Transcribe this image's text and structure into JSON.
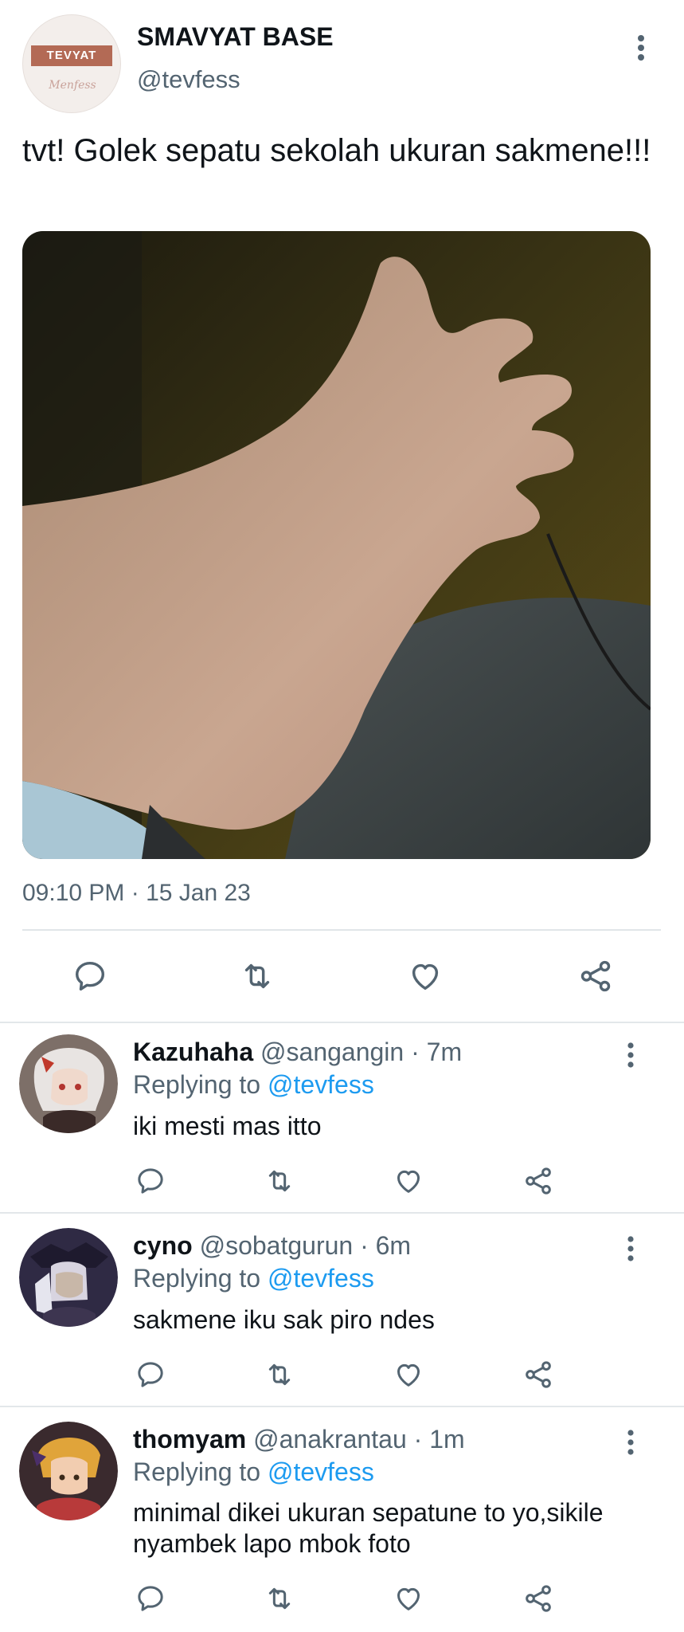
{
  "main_tweet": {
    "account": {
      "name": "SMAVYAT BASE",
      "handle": "@tevfess",
      "avatar_banner_text": "TEVYAT",
      "avatar_script_text": "Menfess"
    },
    "text": "tvt! Golek sepatu sekolah ukuran sakmene!!!",
    "timestamp": "09:10 PM · 15 Jan 23",
    "actions": [
      "reply-icon",
      "retweet-icon",
      "like-icon",
      "share-icon"
    ]
  },
  "replies": [
    {
      "name": "Kazuhaha",
      "handle_time": "@sangangin · 7m",
      "replying_prefix": "Replying to",
      "replying_to": "@tevfess",
      "text": "iki mesti mas itto"
    },
    {
      "name": "cyno",
      "handle_time": "@sobatgurun · 6m",
      "replying_prefix": "Replying to",
      "replying_to": "@tevfess",
      "text": "sakmene iku sak piro ndes"
    },
    {
      "name": "thomyam",
      "handle_time": "@anakrantau · 1m",
      "replying_prefix": "Replying to",
      "replying_to": "@tevfess",
      "text": "minimal dikei ukuran sepatune to yo,sikile nyambek lapo mbok foto"
    }
  ],
  "colors": {
    "text_primary": "#0f1419",
    "text_secondary": "#536471",
    "link": "#1d9bf0",
    "divider": "#e3e7ea"
  }
}
